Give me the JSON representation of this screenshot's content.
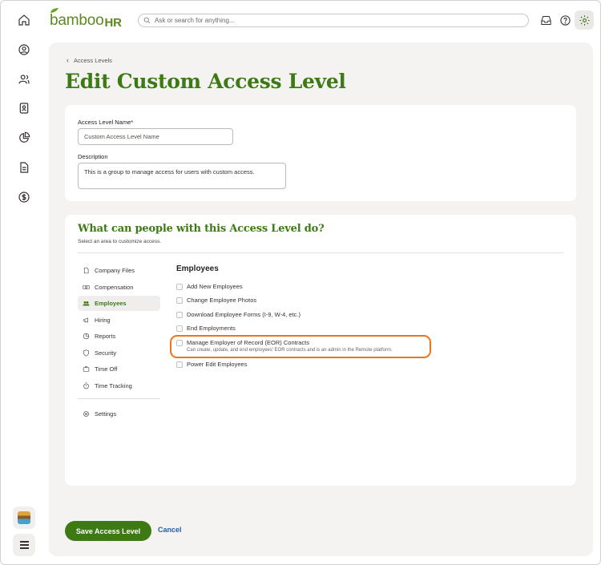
{
  "brand": {
    "logo_text": "bamboo",
    "logo_suffix": "HR",
    "accent": "#3d7a14",
    "highlight": "#e8761c"
  },
  "search": {
    "placeholder": "Ask or search for anything..."
  },
  "leftnav": {
    "icons": [
      "home-icon",
      "person-circle-icon",
      "people-icon",
      "id-badge-icon",
      "pie-chart-icon",
      "document-icon",
      "dollar-circle-icon"
    ],
    "bottom": [
      "avatar",
      "hamburger-menu-icon"
    ]
  },
  "topbar_icons": [
    "inbox-icon",
    "help-icon",
    "gear-icon"
  ],
  "breadcrumb": {
    "label": "Access Levels"
  },
  "page": {
    "title": "Edit Custom Access Level"
  },
  "form": {
    "name_label": "Access Level Name*",
    "name_placeholder": "Custom Access Level Name",
    "desc_label": "Description",
    "desc_value": "This is a group to manage access for users with custom access."
  },
  "access": {
    "title": "What can people with this Access Level do?",
    "subtitle": "Select an area to customize access.",
    "areas": [
      {
        "label": "Company Files",
        "icon": "file-icon"
      },
      {
        "label": "Compensation",
        "icon": "money-icon"
      },
      {
        "label": "Employees",
        "icon": "people-icon",
        "active": true
      },
      {
        "label": "Hiring",
        "icon": "megaphone-icon"
      },
      {
        "label": "Reports",
        "icon": "chart-icon"
      },
      {
        "label": "Security",
        "icon": "shield-icon"
      },
      {
        "label": "Time Off",
        "icon": "suitcase-icon"
      },
      {
        "label": "Time Tracking",
        "icon": "stopwatch-icon"
      }
    ],
    "settings_label": "Settings",
    "section_title": "Employees",
    "permissions": [
      {
        "label": "Add New Employees",
        "checked": false
      },
      {
        "label": "Change Employee Photos",
        "checked": false
      },
      {
        "label": "Download Employee Forms (I-9, W-4, etc.)",
        "checked": false
      },
      {
        "label": "End Employments",
        "checked": false
      },
      {
        "label": "Manage Employer of Record (EOR) Contracts",
        "checked": false,
        "description": "Can create, update, and end employees' EOR contracts and is an admin in the Remote platform."
      },
      {
        "label": "Power Edit Employees",
        "checked": false
      }
    ]
  },
  "actions": {
    "save": "Save Access Level",
    "cancel": "Cancel"
  }
}
